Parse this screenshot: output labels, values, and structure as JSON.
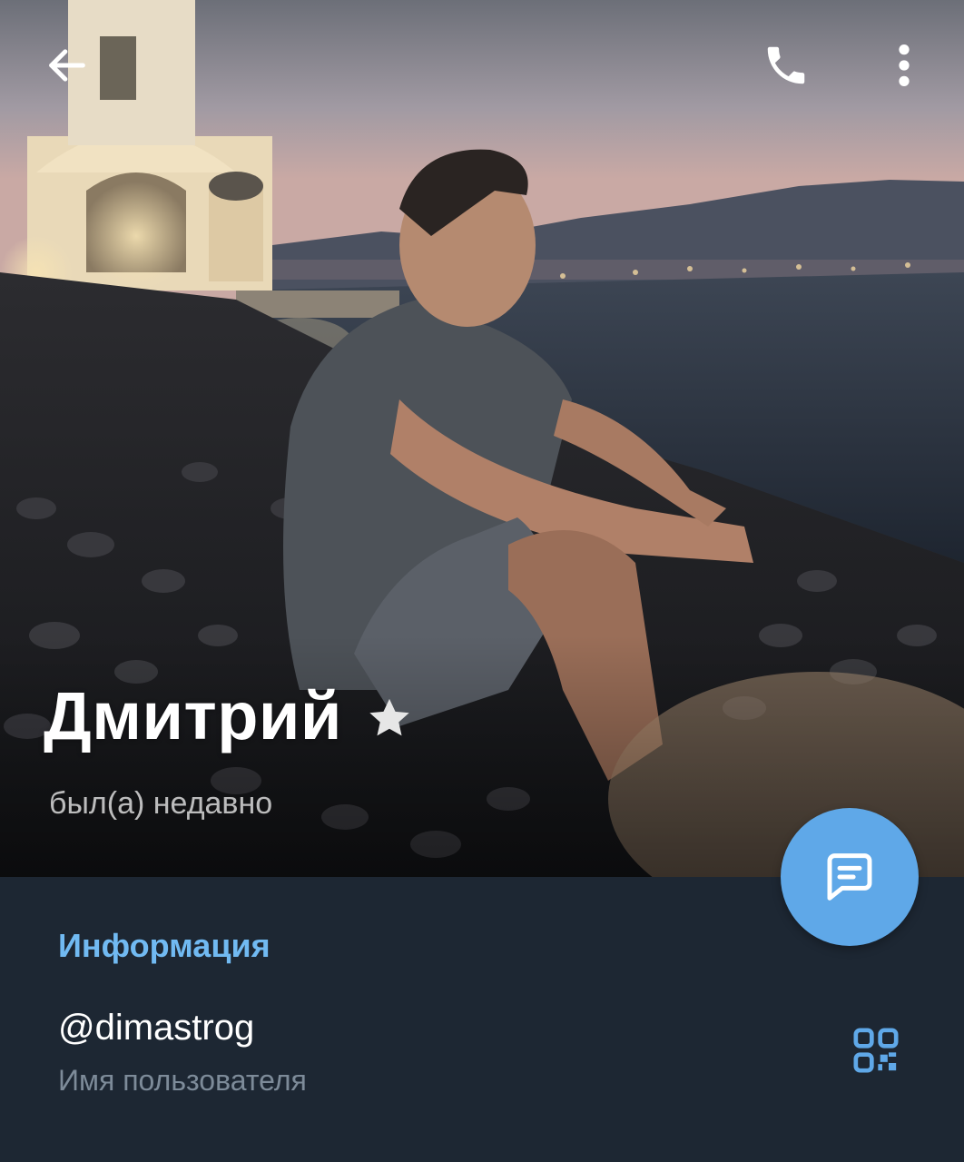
{
  "toolbar": {
    "back_icon": "arrow-left-icon",
    "call_icon": "phone-icon",
    "more_icon": "more-vertical-icon"
  },
  "profile": {
    "name": "Дмитрий",
    "status": "был(а) недавно",
    "badge_icon": "premium-star-icon"
  },
  "info": {
    "section_title": "Информация",
    "username": "@dimastrog",
    "username_caption": "Имя пользователя",
    "qr_icon": "qr-code-icon"
  },
  "fab": {
    "icon": "message-icon"
  },
  "colors": {
    "background": "#1d2733",
    "accent": "#71baf2",
    "fab": "#5fa8e8",
    "caption": "#7d8b99"
  }
}
